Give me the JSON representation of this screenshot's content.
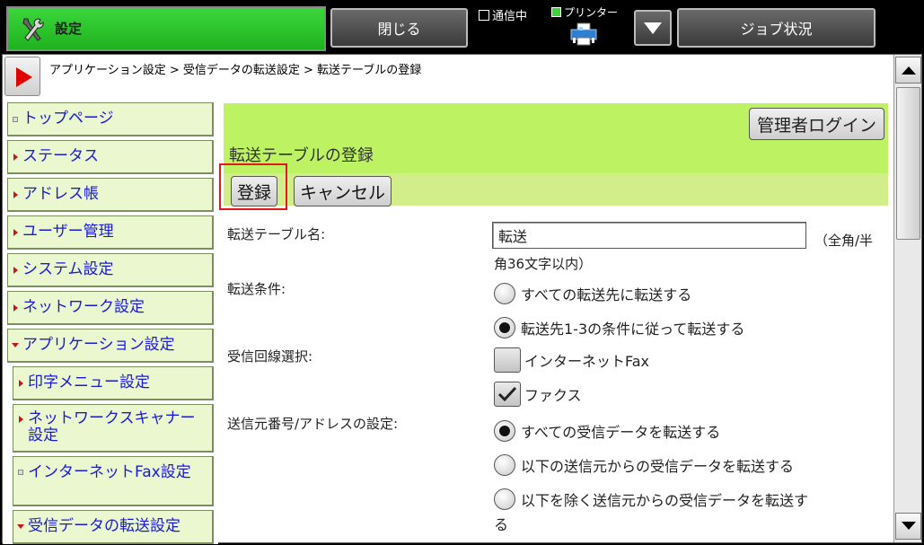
{
  "topbar": {
    "tab_label": "設定",
    "close_label": "閉じる",
    "job_status_label": "ジョブ状況",
    "comm_label": "通信中",
    "printer_label": "プリンター"
  },
  "breadcrumb": "アプリケーション設定 > 受信データの転送設定 > 転送テーブルの登録",
  "sidebar": {
    "items": [
      {
        "label": "トップページ"
      },
      {
        "label": "ステータス"
      },
      {
        "label": "アドレス帳"
      },
      {
        "label": "ユーザー管理"
      },
      {
        "label": "システム設定"
      },
      {
        "label": "ネットワーク設定"
      },
      {
        "label": "アプリケーション設定"
      },
      {
        "label": "印字メニュー設定"
      },
      {
        "label": "ネットワークスキャナー設定"
      },
      {
        "label": "インターネットFax設定"
      },
      {
        "label": "受信データの転送設定"
      }
    ]
  },
  "main": {
    "admin_login_label": "管理者ログイン",
    "title": "転送テーブルの登録",
    "register_label": "登録",
    "cancel_label": "キャンセル",
    "table_name_label": "転送テーブル名:",
    "table_name_value": "転送",
    "table_name_hint_1": "（全角/半",
    "table_name_hint_2": "角36文字以内）",
    "condition_label": "転送条件:",
    "condition_options": [
      {
        "label": "すべての転送先に転送する",
        "selected": false
      },
      {
        "label": "転送先1-3の条件に従って転送する",
        "selected": true
      }
    ],
    "line_label": "受信回線選択:",
    "line_options": [
      {
        "label": "インターネットFax",
        "checked": false
      },
      {
        "label": "ファクス",
        "checked": true
      }
    ],
    "sender_label": "送信元番号/アドレスの設定:",
    "sender_options": [
      {
        "label": "すべての受信データを転送する",
        "selected": true
      },
      {
        "label": "以下の送信元からの受信データを転送する",
        "selected": false
      },
      {
        "label": "以下を除く送信元からの受信データを転送す",
        "selected": false
      }
    ],
    "sender_option_3_wrap": "る"
  }
}
